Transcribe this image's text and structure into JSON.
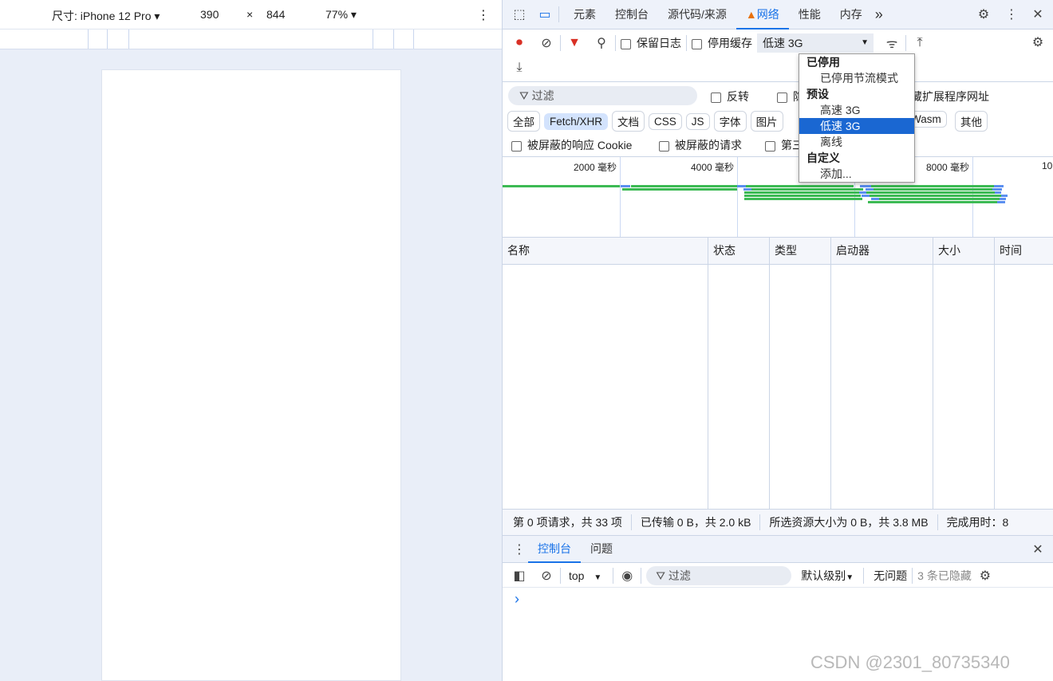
{
  "device_toolbar": {
    "dimensions_label": "尺寸: iPhone 12 Pro",
    "width": "390",
    "times": "×",
    "height": "844",
    "zoom": "77%"
  },
  "devtools": {
    "tabs": [
      {
        "label": "元素"
      },
      {
        "label": "控制台"
      },
      {
        "label": "源代码/来源"
      },
      {
        "label": "网络",
        "active": true,
        "warning": true
      },
      {
        "label": "性能"
      },
      {
        "label": "内存"
      }
    ],
    "more": "»"
  },
  "network": {
    "preserve_log": "保留日志",
    "disable_cache": "停用缓存",
    "throttle": "低速 3G",
    "filter_placeholder": "过滤",
    "invert": "反转",
    "hide_ext_partial": "藏扩展程序网址",
    "hide_data_partial": "隐",
    "types": [
      "全部",
      "Fetch/XHR",
      "文档",
      "CSS",
      "JS",
      "字体",
      "图片",
      "Wasm",
      "其他"
    ],
    "blocked_cookies": "被屏蔽的响应 Cookie",
    "blocked_requests": "被屏蔽的请求",
    "third_party_partial": "第三",
    "timeline_ticks": [
      "2000 毫秒",
      "4000 毫秒",
      "8000 毫秒",
      "10"
    ],
    "columns": [
      "名称",
      "状态",
      "类型",
      "启动器",
      "大小",
      "时间"
    ],
    "status": {
      "requests": "第 0 项请求，共 33 项",
      "transferred": "已传输 0 B，共 2.0 kB",
      "resources": "所选资源大小为 0 B，共 3.8 MB",
      "finish": "完成用时：8"
    },
    "throttle_menu": [
      {
        "type": "header",
        "label": "已停用"
      },
      {
        "type": "item",
        "label": "已停用节流模式"
      },
      {
        "type": "header",
        "label": "预设"
      },
      {
        "type": "item",
        "label": "高速 3G"
      },
      {
        "type": "item",
        "label": "低速 3G",
        "selected": true
      },
      {
        "type": "item",
        "label": "离线"
      },
      {
        "type": "header",
        "label": "自定义"
      },
      {
        "type": "item",
        "label": "添加..."
      }
    ]
  },
  "drawer": {
    "tabs": [
      "控制台",
      "问题"
    ],
    "context": "top",
    "filter_placeholder": "过滤",
    "level": "默认级别",
    "issues": "无问题",
    "hidden": "3 条已隐藏",
    "prompt": "›"
  },
  "watermark": "CSDN @2301_80735340",
  "colors": {
    "accent": "#1a73e8",
    "bar_green": "#3cba54",
    "bar_blue": "#5b8ff0",
    "record_red": "#d93025"
  }
}
